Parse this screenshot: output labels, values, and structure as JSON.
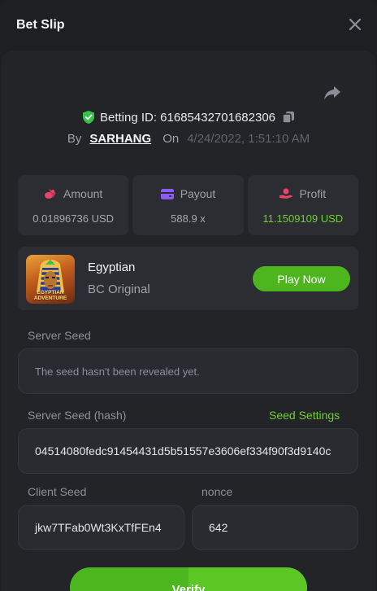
{
  "modal": {
    "title": "Bet Slip"
  },
  "bet": {
    "betting_id_label": "Betting ID: 61685432701682306",
    "by_label": "By",
    "username": "SARHANG",
    "on_label": "On",
    "date": "4/24/2022, 1:51:10 AM"
  },
  "stats": {
    "amount": {
      "label": "Amount",
      "value": "0.01896736 USD"
    },
    "payout": {
      "label": "Payout",
      "value": "588.9 x"
    },
    "profit": {
      "label": "Profit",
      "value": "11.1509109 USD"
    }
  },
  "game": {
    "name": "Egyptian",
    "subtitle": "BC Original",
    "thumb_text": "EGYPTIAN ADVENTURE",
    "play_label": "Play Now"
  },
  "seeds": {
    "server_seed_label": "Server Seed",
    "server_seed_value": "The seed hasn't been revealed yet.",
    "server_hash_label": "Server Seed (hash)",
    "seed_settings_label": "Seed Settings",
    "server_hash_value": "04514080fedc91454431d5b51557e3606ef334f90f3d9140c",
    "client_seed_label": "Client Seed",
    "client_seed_value": "jkw7TFab0Wt3KxTfFEn4",
    "nonce_label": "nonce",
    "nonce_value": "642"
  },
  "verify": {
    "label": "Verify"
  },
  "colors": {
    "accent_green": "#4db61f",
    "profit_green": "#6fd12e",
    "amount_icon": "#e8456a",
    "payout_icon": "#8b5cf6",
    "profit_icon": "#e8456a"
  },
  "icons": {
    "close": "close-icon",
    "share": "share-icon",
    "shield": "shield-check-icon",
    "copy": "copy-icon",
    "amount": "coins-icon",
    "payout": "wallet-icon",
    "profit": "hand-coin-icon"
  }
}
